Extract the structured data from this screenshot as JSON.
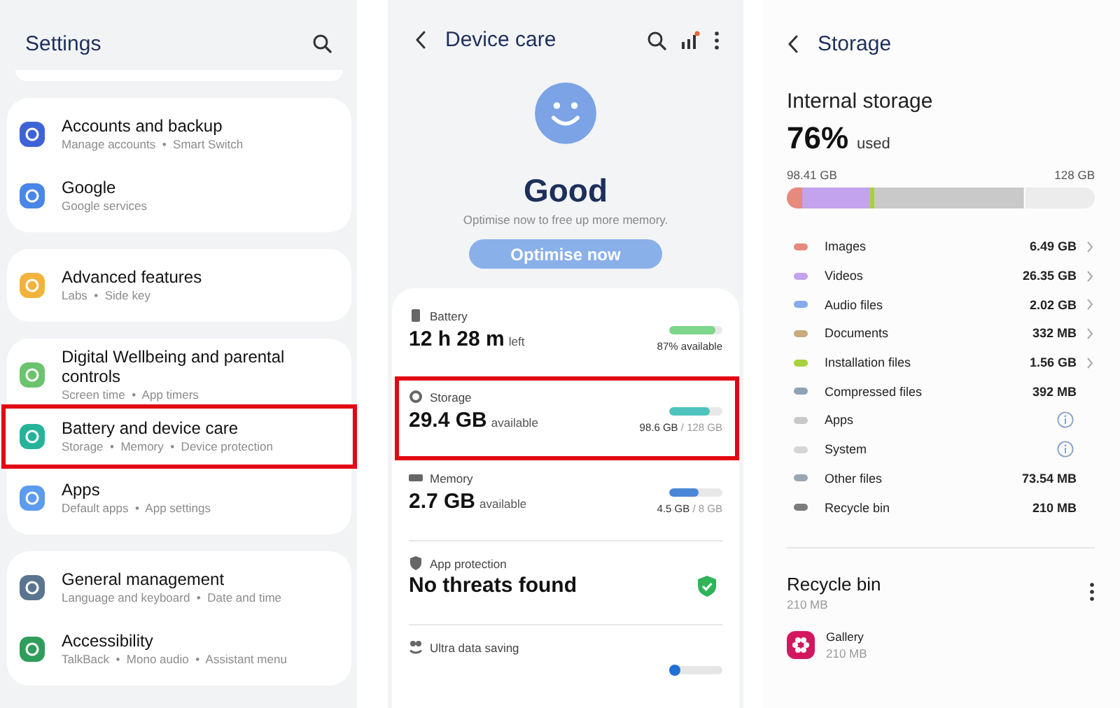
{
  "settings": {
    "title": "Settings",
    "groups": [
      {
        "items": [
          {
            "title": "Accounts and backup",
            "subtitle": "Manage accounts  •  Smart Switch",
            "color": "#3f63d6",
            "highlighted": false
          },
          {
            "title": "Google",
            "subtitle": "Google services",
            "color": "#4a86e8",
            "highlighted": false
          }
        ]
      },
      {
        "items": [
          {
            "title": "Advanced features",
            "subtitle": "Labs  •  Side key",
            "color": "#f2b33d",
            "highlighted": false
          }
        ]
      },
      {
        "items": [
          {
            "title": "Digital Wellbeing and parental controls",
            "subtitle": "Screen time  •  App timers",
            "color": "#6bc46d",
            "highlighted": false
          },
          {
            "title": "Battery and device care",
            "subtitle": "Storage  •  Memory  •  Device protection",
            "color": "#25b39a",
            "highlighted": true
          },
          {
            "title": "Apps",
            "subtitle": "Default apps  •  App settings",
            "color": "#5c9bef",
            "highlighted": false
          }
        ]
      },
      {
        "items": [
          {
            "title": "General management",
            "subtitle": "Language and keyboard  •  Date and time",
            "color": "#5a7590",
            "highlighted": false
          },
          {
            "title": "Accessibility",
            "subtitle": "TalkBack  •  Mono audio  •  Assistant menu",
            "color": "#2e9e5a",
            "highlighted": false
          }
        ]
      }
    ]
  },
  "device_care": {
    "title": "Device care",
    "status": "Good",
    "hint": "Optimise now to free up more memory.",
    "button": "Optimise now",
    "sections": [
      {
        "kind": "meter",
        "label": "Battery",
        "value": "12 h 28 m",
        "unit": "left",
        "reading": "87% available",
        "level": 0.87,
        "color": "#7dd68a",
        "highlighted": false
      },
      {
        "kind": "meter",
        "label": "Storage",
        "value": "29.4 GB",
        "unit": "available",
        "reading": "98.6 GB",
        "reading_total": "/ 128 GB",
        "level": 0.77,
        "color": "#4fc3bd",
        "highlighted": true
      },
      {
        "kind": "meter",
        "label": "Memory",
        "value": "2.7 GB",
        "unit": "available",
        "reading": "4.5 GB",
        "reading_total": "/ 8 GB",
        "level": 0.56,
        "color": "#4a86d8",
        "highlighted": false
      },
      {
        "kind": "protection",
        "label": "App protection",
        "value": "No threats found"
      },
      {
        "kind": "toggle",
        "label": "Ultra data saving",
        "on": false
      }
    ]
  },
  "storage": {
    "title": "Storage",
    "heading": "Internal storage",
    "percent": "76%",
    "percent_label": "used",
    "used": "98.41 GB",
    "total": "128 GB",
    "categories": [
      {
        "kind": "size",
        "name": "Images",
        "size": "6.49 GB",
        "color": "#e58a7d",
        "has_details": true
      },
      {
        "kind": "size",
        "name": "Videos",
        "size": "26.35 GB",
        "color": "#c3a2ee",
        "has_details": true
      },
      {
        "kind": "size",
        "name": "Audio files",
        "size": "2.02 GB",
        "color": "#84aaea",
        "has_details": true
      },
      {
        "kind": "size",
        "name": "Documents",
        "size": "332 MB",
        "color": "#c9ab7d",
        "has_details": true
      },
      {
        "kind": "size",
        "name": "Installation files",
        "size": "1.56 GB",
        "color": "#a8d13e",
        "has_details": true
      },
      {
        "kind": "size",
        "name": "Compressed files",
        "size": "392 MB",
        "color": "#8fa3b6",
        "has_details": false
      },
      {
        "kind": "info",
        "name": "Apps",
        "color": "#c9c9c9"
      },
      {
        "kind": "info",
        "name": "System",
        "color": "#d6d6d6"
      },
      {
        "kind": "size",
        "name": "Other files",
        "size": "73.54 MB",
        "color": "#99a7b4",
        "has_details": false
      },
      {
        "kind": "size",
        "name": "Recycle bin",
        "size": "210 MB",
        "color": "#7c7c7c",
        "has_details": false
      }
    ],
    "recycle_bin": {
      "title": "Recycle bin",
      "size": "210 MB",
      "items": [
        {
          "name": "Gallery",
          "size": "210 MB",
          "color": "#d3175f"
        }
      ]
    }
  }
}
